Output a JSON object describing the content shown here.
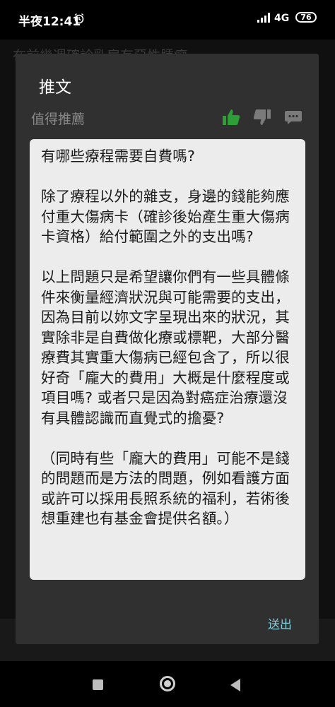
{
  "status_bar": {
    "time": "半夜12:41",
    "network": "4G",
    "battery": "76"
  },
  "background": {
    "top_text": "在前幾週確診乳房有惡性腫瘤"
  },
  "dialog": {
    "title": "推文",
    "rating_label": "值得推薦",
    "content_paragraphs": [
      "有哪些療程需要自費嗎?",
      "除了療程以外的雜支，身邊的錢能夠應付重大傷病卡（確診後始產生重大傷病卡資格）給付範圍之外的支出嗎?",
      "以上問題只是希望讓你們有一些具體條件來衡量經濟狀況與可能需要的支出，因為目前以妳文字呈現出來的狀況，其實除非是自費做化療或標靶，大部分醫療費其實重大傷病已經包含了，所以很好奇「龐大的費用」大概是什麼程度或項目嗎? 或者只是因為對癌症治療還沒有具體認識而直覺式的擔憂?",
      "（同時有些「龐大的費用」可能不是錢的問題而是方法的問題，例如看護方面或許可以採用長照系統的福利，若術後想重建也有基金會提供名額。）"
    ],
    "send_label": "送出"
  },
  "colors": {
    "thumbs_up_active": "#2e9e36",
    "icon_inactive": "#7a7a7a",
    "send_accent": "#7fcfdc"
  }
}
